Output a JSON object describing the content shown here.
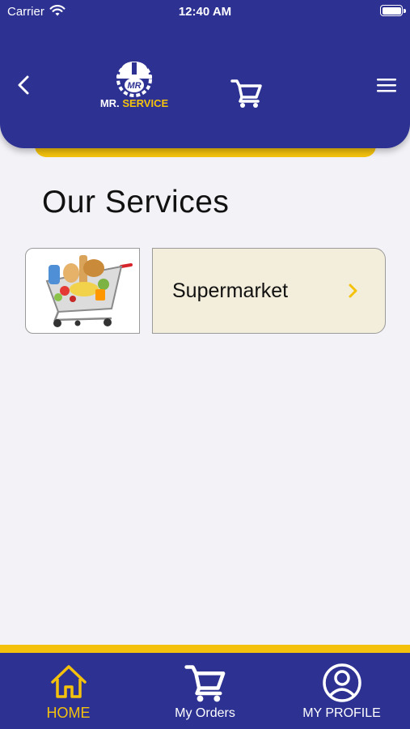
{
  "status_bar": {
    "carrier": "Carrier",
    "time": "12:40 AM"
  },
  "header": {
    "logo_badge": "MR",
    "logo_text_1": "MR.",
    "logo_text_2": "SERVICE",
    "back_icon": "chevron-left-icon",
    "cart_icon": "cart-icon",
    "menu_icon": "hamburger-icon"
  },
  "main": {
    "section_title": "Our Services",
    "services": [
      {
        "label": "Supermarket",
        "image": "shopping-cart-groceries",
        "icon": "chevron-right-icon"
      }
    ]
  },
  "tabbar": {
    "tabs": [
      {
        "label": "HOME",
        "icon": "home-icon",
        "active": true
      },
      {
        "label": "My Orders",
        "icon": "cart-icon",
        "active": false
      },
      {
        "label": "MY PROFILE",
        "icon": "profile-icon",
        "active": false
      }
    ]
  },
  "colors": {
    "primary": "#2c3192",
    "accent": "#f4c20d",
    "card": "#f3eedb",
    "background": "#f2f2f7"
  }
}
